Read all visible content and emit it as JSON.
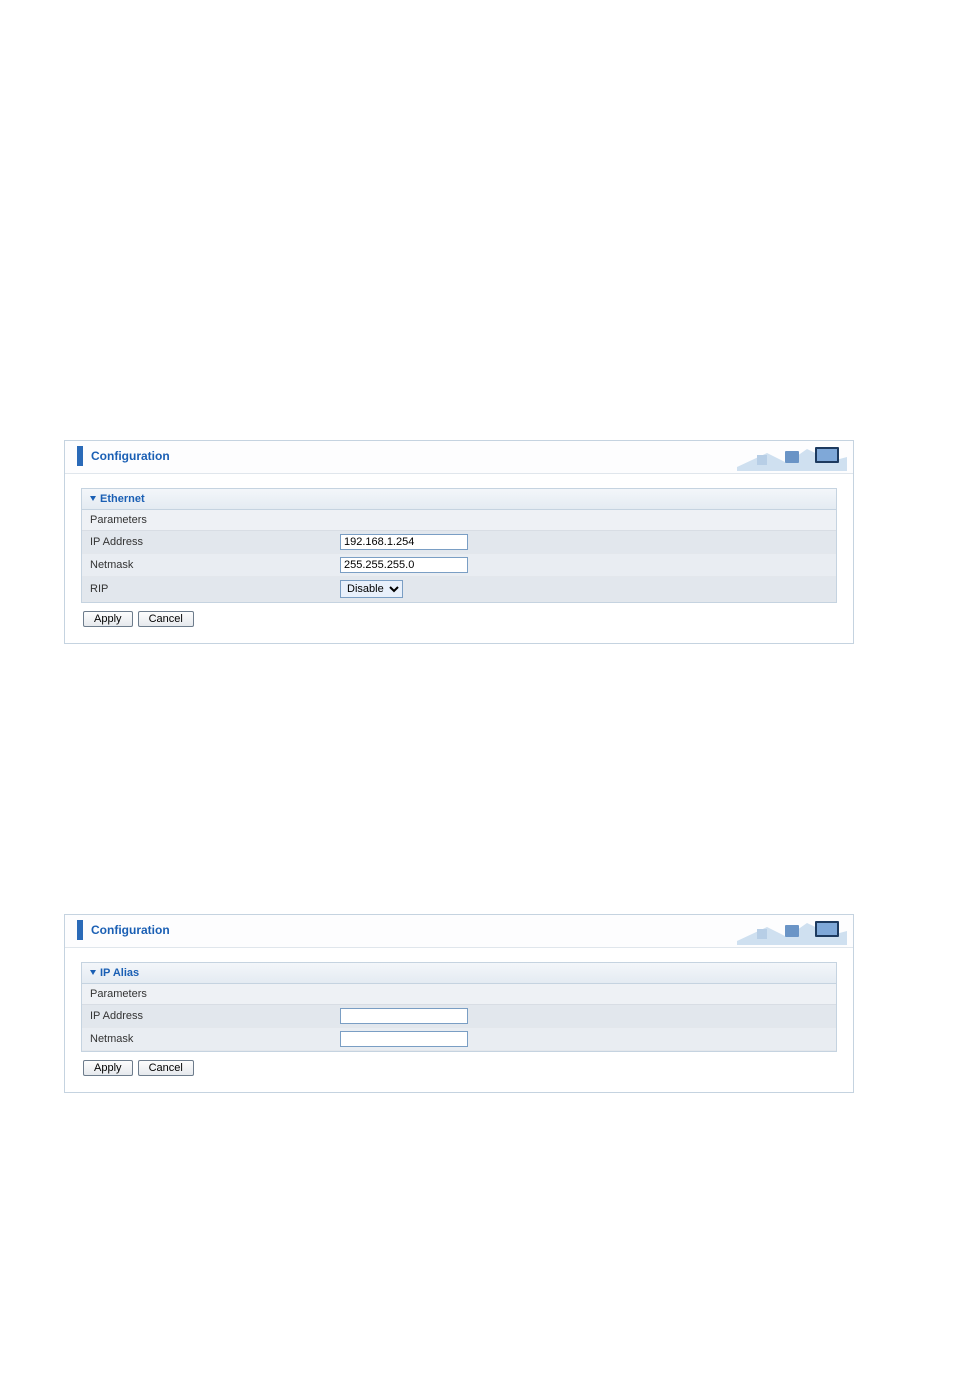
{
  "panel1": {
    "header": "Configuration",
    "section_title": "Ethernet",
    "parameters_label": "Parameters",
    "rows": {
      "ip_label": "IP Address",
      "ip_value": "192.168.1.254",
      "netmask_label": "Netmask",
      "netmask_value": "255.255.255.0",
      "rip_label": "RIP",
      "rip_value": "Disable"
    },
    "buttons": {
      "apply": "Apply",
      "cancel": "Cancel"
    }
  },
  "panel2": {
    "header": "Configuration",
    "section_title": "IP Alias",
    "parameters_label": "Parameters",
    "rows": {
      "ip_label": "IP Address",
      "ip_value": "",
      "netmask_label": "Netmask",
      "netmask_value": ""
    },
    "buttons": {
      "apply": "Apply",
      "cancel": "Cancel"
    }
  }
}
